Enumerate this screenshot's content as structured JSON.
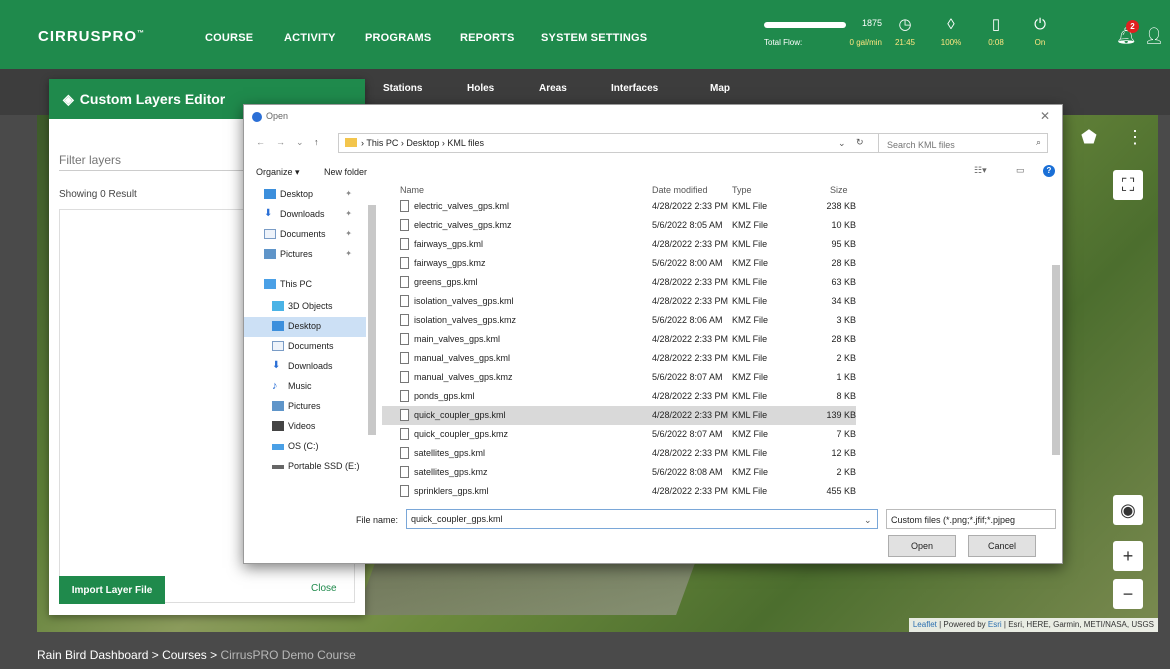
{
  "header": {
    "logo": "CIRRUSPRO",
    "logo_tm": "™",
    "nav": [
      "COURSE",
      "ACTIVITY",
      "PROGRAMS",
      "REPORTS",
      "SYSTEM SETTINGS"
    ],
    "flow_number": "1875",
    "flow_label": "Total Flow:",
    "flow_value": "0 gal/min",
    "stats": [
      {
        "icon": "clock-icon",
        "glyph": "◷",
        "value": "21:45"
      },
      {
        "icon": "water-drop-icon",
        "glyph": "◊",
        "value": "100%"
      },
      {
        "icon": "battery-icon",
        "glyph": "▯",
        "value": "0:08"
      },
      {
        "icon": "power-icon",
        "glyph": "⏻",
        "value": "On"
      }
    ],
    "notification_count": "2"
  },
  "subnav": [
    "Stations",
    "Holes",
    "Areas",
    "Interfaces",
    "Map"
  ],
  "editor": {
    "title": "Custom Layers Editor",
    "filter_placeholder": "Filter layers",
    "result_text": "Showing 0 Result",
    "import_label": "Import Layer File",
    "close_label": "Close"
  },
  "dialog": {
    "title": "Open",
    "path": "› This PC › Desktop › KML files",
    "search_placeholder": "Search KML files",
    "organize_label": "Organize ▾",
    "new_folder_label": "New folder",
    "nav_items": [
      {
        "label": "Desktop",
        "pinned": true
      },
      {
        "label": "Downloads",
        "pinned": true
      },
      {
        "label": "Documents",
        "pinned": true
      },
      {
        "label": "Pictures",
        "pinned": true
      },
      {
        "label": "This PC",
        "pinned": false
      },
      {
        "label": "3D Objects",
        "pinned": false
      },
      {
        "label": "Desktop",
        "pinned": false
      },
      {
        "label": "Documents",
        "pinned": false
      },
      {
        "label": "Downloads",
        "pinned": false
      },
      {
        "label": "Music",
        "pinned": false
      },
      {
        "label": "Pictures",
        "pinned": false
      },
      {
        "label": "Videos",
        "pinned": false
      },
      {
        "label": "OS (C:)",
        "pinned": false
      },
      {
        "label": "Portable SSD (E:)",
        "pinned": false
      }
    ],
    "columns": [
      "Name",
      "Date modified",
      "Type",
      "Size"
    ],
    "files": [
      {
        "name": "electric_valves_gps.kml",
        "date": "4/28/2022 2:33 PM",
        "type": "KML File",
        "size": "238 KB"
      },
      {
        "name": "electric_valves_gps.kmz",
        "date": "5/6/2022 8:05 AM",
        "type": "KMZ File",
        "size": "10 KB"
      },
      {
        "name": "fairways_gps.kml",
        "date": "4/28/2022 2:33 PM",
        "type": "KML File",
        "size": "95 KB"
      },
      {
        "name": "fairways_gps.kmz",
        "date": "5/6/2022 8:00 AM",
        "type": "KMZ File",
        "size": "28 KB"
      },
      {
        "name": "greens_gps.kml",
        "date": "4/28/2022 2:33 PM",
        "type": "KML File",
        "size": "63 KB"
      },
      {
        "name": "isolation_valves_gps.kml",
        "date": "4/28/2022 2:33 PM",
        "type": "KML File",
        "size": "34 KB"
      },
      {
        "name": "isolation_valves_gps.kmz",
        "date": "5/6/2022 8:06 AM",
        "type": "KMZ File",
        "size": "3 KB"
      },
      {
        "name": "main_valves_gps.kml",
        "date": "4/28/2022 2:33 PM",
        "type": "KML File",
        "size": "28 KB"
      },
      {
        "name": "manual_valves_gps.kml",
        "date": "4/28/2022 2:33 PM",
        "type": "KML File",
        "size": "2 KB"
      },
      {
        "name": "manual_valves_gps.kmz",
        "date": "5/6/2022 8:07 AM",
        "type": "KMZ File",
        "size": "1 KB"
      },
      {
        "name": "ponds_gps.kml",
        "date": "4/28/2022 2:33 PM",
        "type": "KML File",
        "size": "8 KB"
      },
      {
        "name": "quick_coupler_gps.kml",
        "date": "4/28/2022 2:33 PM",
        "type": "KML File",
        "size": "139 KB",
        "selected": true
      },
      {
        "name": "quick_coupler_gps.kmz",
        "date": "5/6/2022 8:07 AM",
        "type": "KMZ File",
        "size": "7 KB"
      },
      {
        "name": "satellites_gps.kml",
        "date": "4/28/2022 2:33 PM",
        "type": "KML File",
        "size": "12 KB"
      },
      {
        "name": "satellites_gps.kmz",
        "date": "5/6/2022 8:08 AM",
        "type": "KMZ File",
        "size": "2 KB"
      },
      {
        "name": "sprinklers_gps.kml",
        "date": "4/28/2022 2:33 PM",
        "type": "KML File",
        "size": "455 KB"
      }
    ],
    "file_name_label": "File name:",
    "file_name_value": "quick_coupler_gps.kml",
    "file_type": "Custom files (*.png;*.jfif;*.pjpeg",
    "open_label": "Open",
    "cancel_label": "Cancel"
  },
  "map": {
    "attribution_leaflet": "Leaflet",
    "attribution_mid": " | Powered by ",
    "attribution_esri": "Esri",
    "attribution_rest": " | Esri, HERE, Garmin, METI/NASA, USGS"
  },
  "breadcrumb": {
    "part1": "Rain Bird Dashboard",
    "sep": " > ",
    "part2": "Courses",
    "current": "CirrusPRO Demo Course"
  },
  "colors": {
    "brand_green": "#1f8a4c",
    "selection_blue": "#cce0f5"
  }
}
